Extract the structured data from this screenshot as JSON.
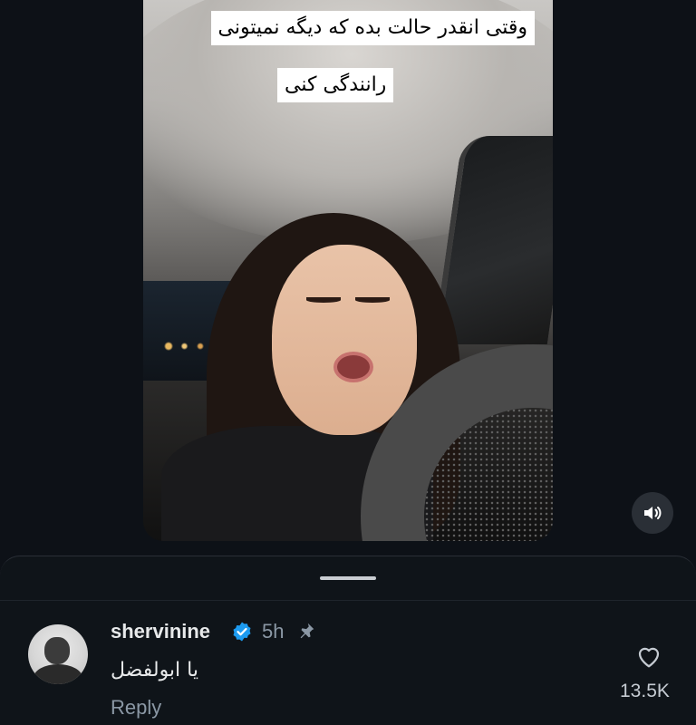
{
  "video": {
    "caption_line1": "وقتی انقدر حالت بده که دیگه نمیتونی",
    "caption_line2": "رانندگی کنی",
    "sound_icon": "speaker-sound-on-icon"
  },
  "comment": {
    "username": "shervinine",
    "verified_icon": "verified-badge-icon",
    "time": "5h",
    "pin_icon": "pin-icon",
    "text": "یا ابولفضل",
    "reply_label": "Reply",
    "like_icon": "heart-outline-icon",
    "like_count": "13.5K"
  },
  "colors": {
    "background": "#0d1117",
    "verified": "#1d9bf0",
    "muted_text": "#8b98a5",
    "primary_text": "#e7e9ea"
  }
}
